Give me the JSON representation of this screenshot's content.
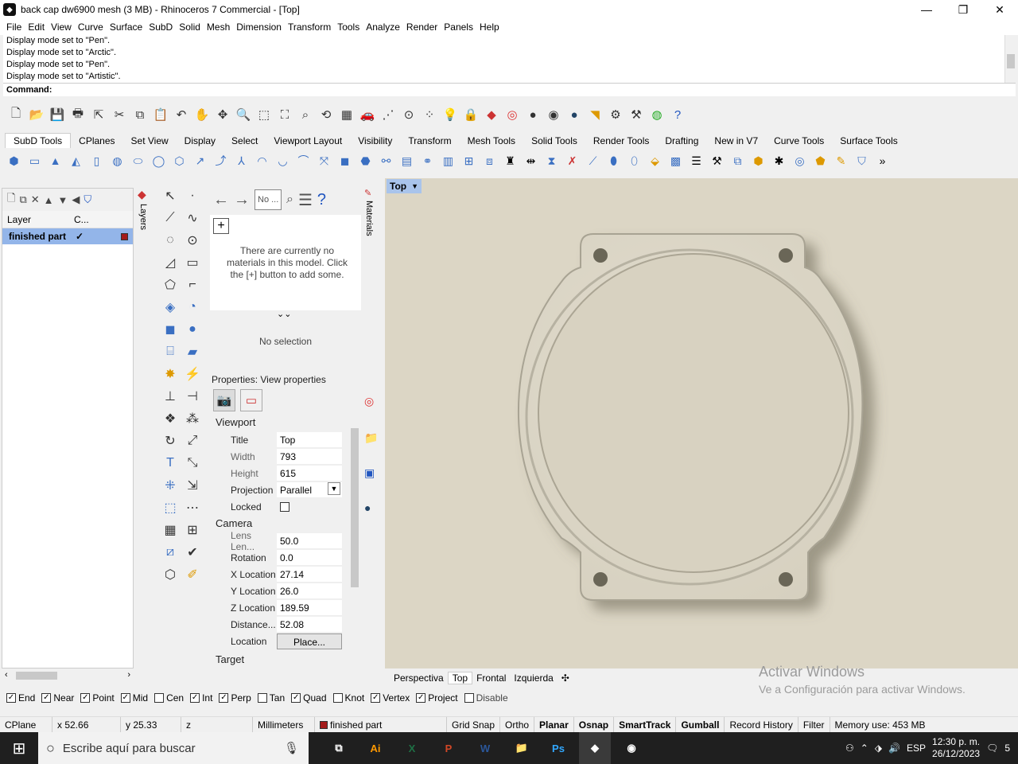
{
  "window": {
    "title": "back cap dw6900 mesh (3 MB) - Rhinoceros 7 Commercial - [Top]",
    "minimize": "—",
    "restore": "❐",
    "close": "✕"
  },
  "menu": [
    "File",
    "Edit",
    "View",
    "Curve",
    "Surface",
    "SubD",
    "Solid",
    "Mesh",
    "Dimension",
    "Transform",
    "Tools",
    "Analyze",
    "Render",
    "Panels",
    "Help"
  ],
  "history": [
    "Display mode set to \"Pen\".",
    "Display mode set to \"Arctic\".",
    "Display mode set to \"Pen\".",
    "Display mode set to \"Artistic\"."
  ],
  "command_label": "Command:",
  "toolbar_tabs": [
    "SubD Tools",
    "CPlanes",
    "Set View",
    "Display",
    "Select",
    "Viewport Layout",
    "Visibility",
    "Transform",
    "Mesh Tools",
    "Solid Tools",
    "Render Tools",
    "Drafting",
    "New in V7",
    "Curve Tools",
    "Surface Tools"
  ],
  "layers": {
    "tab_label": "Layers",
    "col_layer": "Layer",
    "col_current": "C...",
    "row_name": "finished part",
    "row_check": "✓",
    "row_color": "#a41b1b"
  },
  "materials": {
    "tab_label": "Materials",
    "search_placeholder": "No ...",
    "empty_msg": "There are currently no materials in this model. Click the [+] button to add some.",
    "no_selection": "No selection"
  },
  "properties": {
    "header": "Properties: View properties",
    "viewport_section": "Viewport",
    "camera_section": "Camera",
    "target_section": "Target",
    "viewport_rows": [
      {
        "label": "Title",
        "value": "Top"
      },
      {
        "label": "Width",
        "value": "793"
      },
      {
        "label": "Height",
        "value": "615"
      },
      {
        "label": "Projection",
        "value": "Parallel"
      },
      {
        "label": "Locked",
        "value": ""
      }
    ],
    "camera_rows": [
      {
        "label": "Lens Len...",
        "value": "50.0"
      },
      {
        "label": "Rotation",
        "value": "0.0"
      },
      {
        "label": "X Location",
        "value": "27.14"
      },
      {
        "label": "Y Location",
        "value": "26.0"
      },
      {
        "label": "Z Location",
        "value": "189.59"
      },
      {
        "label": "Distance...",
        "value": "52.08"
      },
      {
        "label": "Location",
        "value": "Place..."
      }
    ]
  },
  "viewport": {
    "active_label": "Top",
    "tabs": [
      "Perspectiva",
      "Top",
      "Frontal",
      "Izquierda"
    ],
    "add_tab": "✣"
  },
  "watermark": {
    "line1": "Activar Windows",
    "line2": "Ve a Configuración para activar Windows."
  },
  "osnaps": [
    {
      "label": "End",
      "checked": true
    },
    {
      "label": "Near",
      "checked": true
    },
    {
      "label": "Point",
      "checked": true
    },
    {
      "label": "Mid",
      "checked": true
    },
    {
      "label": "Cen",
      "checked": false
    },
    {
      "label": "Int",
      "checked": true
    },
    {
      "label": "Perp",
      "checked": true
    },
    {
      "label": "Tan",
      "checked": false
    },
    {
      "label": "Quad",
      "checked": true
    },
    {
      "label": "Knot",
      "checked": false
    },
    {
      "label": "Vertex",
      "checked": true
    },
    {
      "label": "Project",
      "checked": true
    },
    {
      "label": "Disable",
      "checked": false
    }
  ],
  "status": {
    "cplane": "CPlane",
    "x": "x 52.66",
    "y": "y 25.33",
    "z": "z",
    "units": "Millimeters",
    "layer": "finished part",
    "grid_snap": "Grid Snap",
    "ortho": "Ortho",
    "planar": "Planar",
    "osnap": "Osnap",
    "smarttrack": "SmartTrack",
    "gumball": "Gumball",
    "record_history": "Record History",
    "filter": "Filter",
    "memory": "Memory use: 453 MB"
  },
  "taskbar": {
    "search_placeholder": "Escribe aquí para buscar",
    "lang": "ESP",
    "time": "12:30 p. m.",
    "date": "26/12/2023",
    "notif_count": "5"
  }
}
